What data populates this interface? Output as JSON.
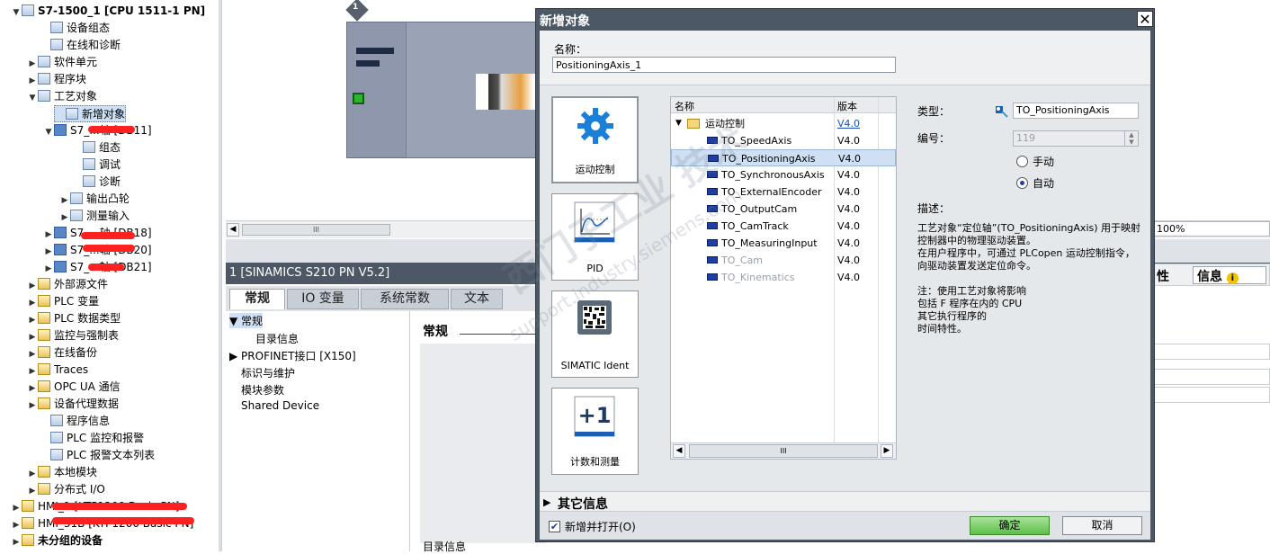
{
  "tree": {
    "items": [
      {
        "label": "S7-1500_1 [CPU 1511-1 PN]",
        "indent": 26,
        "arrow": "▼",
        "icon": "cpu-icon"
      },
      {
        "label": "设备组态",
        "indent": 58,
        "arrow": "",
        "icon": "device-config-icon"
      },
      {
        "label": "在线和诊断",
        "indent": 58,
        "arrow": "",
        "icon": "online-diagnostics-icon"
      },
      {
        "label": "软件单元",
        "indent": 44,
        "arrow": "▶",
        "icon": "software-units-icon"
      },
      {
        "label": "程序块",
        "indent": 44,
        "arrow": "▶",
        "icon": "program-blocks-icon"
      },
      {
        "label": "工艺对象",
        "indent": 44,
        "arrow": "▼",
        "icon": "technology-objects-icon"
      },
      {
        "label": "新增对象",
        "indent": 74,
        "arrow": "",
        "icon": "add-object-icon"
      },
      {
        "label": "S7_...轴 [DB11]",
        "indent": 62,
        "arrow": "▼",
        "icon": "axis-icon"
      },
      {
        "label": "组态",
        "indent": 94,
        "arrow": "",
        "icon": "config-icon"
      },
      {
        "label": "调试",
        "indent": 94,
        "arrow": "",
        "icon": "commissioning-icon"
      },
      {
        "label": "诊断",
        "indent": 94,
        "arrow": "",
        "icon": "diagnostics-icon"
      },
      {
        "label": "输出凸轮",
        "indent": 80,
        "arrow": "▶",
        "icon": "output-cam-icon"
      },
      {
        "label": "测量输入",
        "indent": 80,
        "arrow": "▶",
        "icon": "measuring-input-icon"
      },
      {
        "label": "S7_...轴 [DB18]",
        "indent": 62,
        "arrow": "▶",
        "icon": "axis-icon"
      },
      {
        "label": "S7_...轴 [DB20]",
        "indent": 62,
        "arrow": "▶",
        "icon": "axis-icon"
      },
      {
        "label": "S7_...轴 [DB21]",
        "indent": 62,
        "arrow": "▶",
        "icon": "axis-icon"
      },
      {
        "label": "外部源文件",
        "indent": 44,
        "arrow": "▶",
        "icon": "external-source-icon"
      },
      {
        "label": "PLC 变量",
        "indent": 44,
        "arrow": "▶",
        "icon": "plc-tags-icon"
      },
      {
        "label": "PLC 数据类型",
        "indent": 44,
        "arrow": "▶",
        "icon": "plc-datatypes-icon"
      },
      {
        "label": "监控与强制表",
        "indent": 44,
        "arrow": "▶",
        "icon": "watch-tables-icon"
      },
      {
        "label": "在线备份",
        "indent": 44,
        "arrow": "▶",
        "icon": "online-backup-icon"
      },
      {
        "label": "Traces",
        "indent": 44,
        "arrow": "▶",
        "icon": "traces-icon"
      },
      {
        "label": "OPC UA 通信",
        "indent": 44,
        "arrow": "▶",
        "icon": "opc-ua-icon"
      },
      {
        "label": "设备代理数据",
        "indent": 44,
        "arrow": "▶",
        "icon": "device-proxy-icon"
      },
      {
        "label": "程序信息",
        "indent": 58,
        "arrow": "",
        "icon": "program-info-icon"
      },
      {
        "label": "PLC 监控和报警",
        "indent": 58,
        "arrow": "",
        "icon": "plc-alarms-icon"
      },
      {
        "label": "PLC 报警文本列表",
        "indent": 58,
        "arrow": "",
        "icon": "alarm-text-icon"
      },
      {
        "label": "本地模块",
        "indent": 44,
        "arrow": "▶",
        "icon": "local-modules-icon"
      },
      {
        "label": "分布式 I/O",
        "indent": 44,
        "arrow": "▶",
        "icon": "distributed-io-icon"
      },
      {
        "label": "HMI_1 [KTP1200 Basic PN]",
        "indent": 26,
        "arrow": "▶",
        "icon": "hmi-icon"
      },
      {
        "label": "HMI_31B [KTP1200 Basic PN]",
        "indent": 26,
        "arrow": "▶",
        "icon": "hmi-icon"
      },
      {
        "label": "未分组的设备",
        "indent": 26,
        "arrow": "▶",
        "icon": "ungrouped-devices-icon"
      }
    ]
  },
  "device_view": {
    "rack_number": "1",
    "zoom": "100%"
  },
  "inspector": {
    "title": "1 [SINAMICS S210 PN V5.2]",
    "tabs": [
      "常规",
      "IO 变量",
      "系统常数",
      "文本"
    ],
    "nav": [
      "常规",
      "目录信息",
      "PROFINET接口 [X150]",
      "标识与维护",
      "模块参数",
      "Shared Device"
    ],
    "heading": "常规",
    "footer": "目录信息",
    "right_tabs": [
      "性",
      "信息"
    ]
  },
  "dialog": {
    "title": "新增对象",
    "close": "✕",
    "name_label": "名称：",
    "name_value": "PositioningAxis_1",
    "categories": [
      {
        "label": "运动控制",
        "icon": "motion-control-gear-icon"
      },
      {
        "label": "PID",
        "icon": "pid-icon"
      },
      {
        "label": "SIMATIC Ident",
        "icon": "simatic-ident-icon"
      },
      {
        "label": "计数和测量",
        "icon": "counting-measuring-icon"
      }
    ],
    "list": {
      "col_name": "名称",
      "col_version": "版本",
      "folder": {
        "name": "运动控制",
        "version": "V4.0"
      },
      "rows": [
        {
          "name": "TO_SpeedAxis",
          "version": "V4.0",
          "disabled": false
        },
        {
          "name": "TO_PositioningAxis",
          "version": "V4.0",
          "disabled": false
        },
        {
          "name": "TO_SynchronousAxis",
          "version": "V4.0",
          "disabled": false
        },
        {
          "name": "TO_ExternalEncoder",
          "version": "V4.0",
          "disabled": false
        },
        {
          "name": "TO_OutputCam",
          "version": "V4.0",
          "disabled": false
        },
        {
          "name": "TO_CamTrack",
          "version": "V4.0",
          "disabled": false
        },
        {
          "name": "TO_MeasuringInput",
          "version": "V4.0",
          "disabled": false
        },
        {
          "name": "TO_Cam",
          "version": "V4.0",
          "disabled": true
        },
        {
          "name": "TO_Kinematics",
          "version": "V4.0",
          "disabled": true
        }
      ],
      "selected_index": 1,
      "scroll_thumb": "III"
    },
    "type_label": "类型：",
    "type_value": "TO_PositioningAxis",
    "number_label": "编号：",
    "number_value": "119",
    "radio_manual": "手动",
    "radio_auto": "自动",
    "radio_selected": "auto",
    "desc_label": "描述：",
    "description": "工艺对象“定位轴”(TO_PositioningAxis) 用于映射控制器中的物理驱动装置。\n在用户程序中，可通过 PLCopen 运动控制指令，向驱动装置发送定位命令。\n\n注：使用工艺对象将影响\n包括 F 程序在内的 CPU\n其它执行程序的\n时间特性。",
    "more_info": "其它信息",
    "add_and_open": "新增并打开(O)",
    "ok": "确定",
    "cancel": "取消"
  },
  "watermark": {
    "line1": "西门子工业 技术",
    "line2": "support.industry.siemens.com"
  }
}
